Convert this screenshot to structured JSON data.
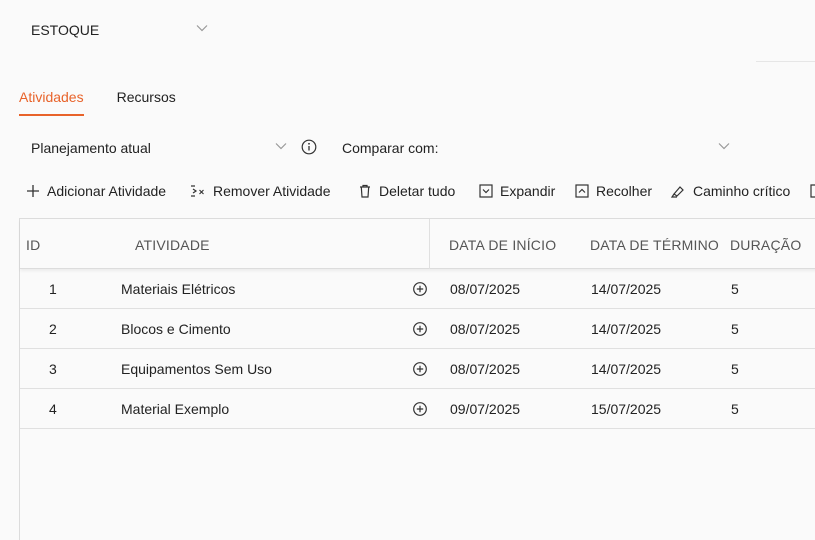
{
  "project": {
    "selected": "ESTOQUE"
  },
  "tabs": [
    {
      "label": "Atividades",
      "active": true
    },
    {
      "label": "Recursos",
      "active": false
    }
  ],
  "plan": {
    "selected": "Planejamento atual"
  },
  "compare": {
    "label": "Comparar com:"
  },
  "toolbar": {
    "add": "Adicionar Atividade",
    "remove": "Remover Atividade",
    "delete_all": "Deletar tudo",
    "expand": "Expandir",
    "collapse": "Recolher",
    "critical_path": "Caminho crítico"
  },
  "table": {
    "headers": {
      "id": "ID",
      "activity": "ATIVIDADE",
      "start": "DATA DE INÍCIO",
      "end": "DATA DE TÉRMINO",
      "duration": "DURAÇÃO"
    },
    "rows": [
      {
        "id": "1",
        "activity": "Materiais Elétricos",
        "start": "08/07/2025",
        "end": "14/07/2025",
        "duration": "5"
      },
      {
        "id": "2",
        "activity": "Blocos e Cimento",
        "start": "08/07/2025",
        "end": "14/07/2025",
        "duration": "5"
      },
      {
        "id": "3",
        "activity": "Equipamentos Sem Uso",
        "start": "08/07/2025",
        "end": "14/07/2025",
        "duration": "5"
      },
      {
        "id": "4",
        "activity": "Material Exemplo",
        "start": "09/07/2025",
        "end": "15/07/2025",
        "duration": "5"
      }
    ]
  },
  "colors": {
    "accent": "#e8632a",
    "border": "#dcdcdc"
  }
}
